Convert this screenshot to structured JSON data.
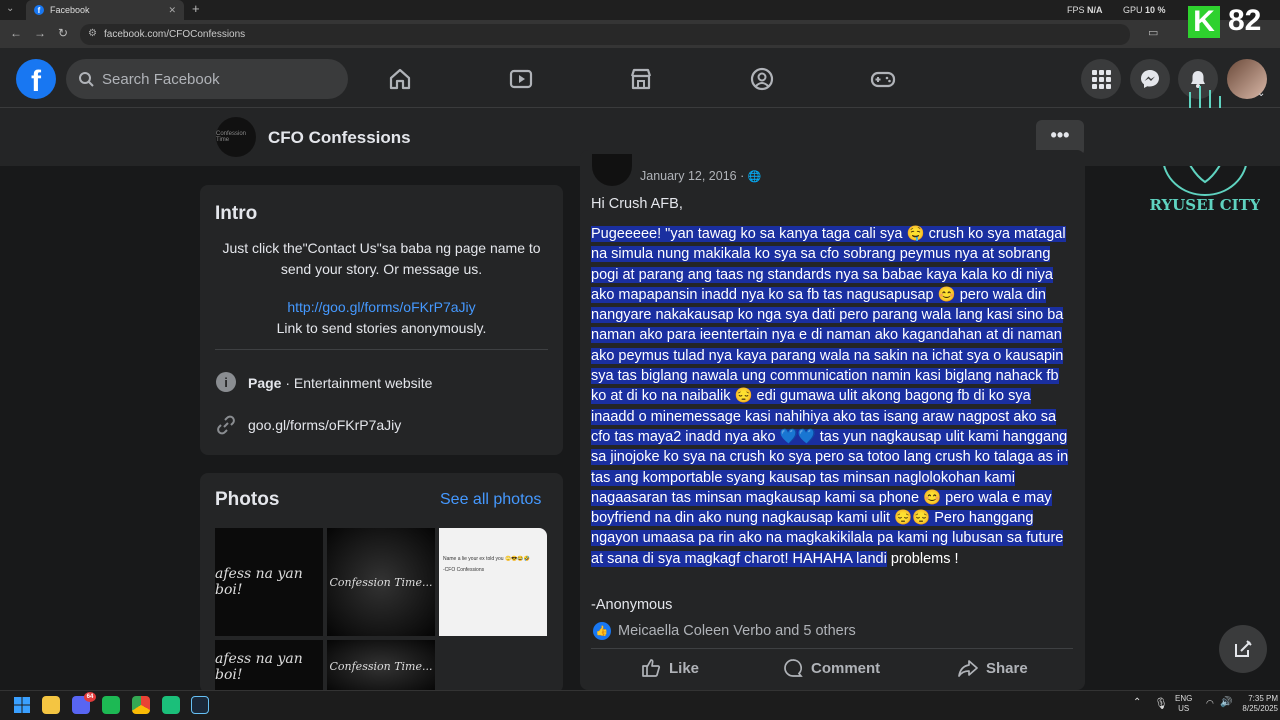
{
  "browser": {
    "tab_title": "Facebook",
    "url": "facebook.com/CFOConfessions",
    "fps_label": "FPS",
    "fps_value": "N/A",
    "gpu_label": "GPU",
    "gpu_value": "10 %",
    "overlay_number": "82",
    "overlay_letter": "K",
    "overlay_brand_text": "RYUSEI CITY"
  },
  "header": {
    "search_placeholder": "Search Facebook",
    "logo_letter": "f"
  },
  "page": {
    "name": "CFO Confessions",
    "avatar_text": "Confession Time",
    "more_label": "•••"
  },
  "intro": {
    "title": "Intro",
    "description": "Just click the\"Contact Us\"sa baba ng page name to send your story. Or message us.",
    "link": "http://goo.gl/forms/oFKrP7aJiy",
    "link_caption": "Link to send stories anonymously.",
    "category_bold": "Page",
    "category_rest": " · Entertainment website",
    "website": "goo.gl/forms/oFKrP7aJiy"
  },
  "photos": {
    "title": "Photos",
    "see_all": "See all photos",
    "items": [
      {
        "text": "afess na yan boi!"
      },
      {
        "text": "Confession Time..."
      },
      {
        "text": "Name a lie your ex told you 🙄😎😂🤣",
        "sub": "-CFO Confessions"
      },
      {
        "text": "afess na yan boi!"
      },
      {
        "text": "Confession Time..."
      }
    ]
  },
  "post": {
    "date": "January 12, 2016 ·",
    "greeting": "Hi Crush AFB,",
    "body": "Pugeeeee! \"yan tawag ko sa kanya taga cali sya 🤤 crush ko sya matagal na simula nung makikala ko sya sa cfo sobrang peymus nya at sobrang pogi at parang ang taas ng standards nya sa babae kaya kala ko di niya ako mapapansin inadd nya ko sa fb tas nagusapusap 😊 pero wala din nangyare nakakausap ko nga sya dati pero parang wala lang kasi sino ba naman ako para ieentertain nya e di naman ako kagandahan at di naman ako peymus tulad nya kaya parang wala na sakin na ichat sya o kausapin sya  tas biglang nawala ung communication namin kasi biglang nahack fb ko at di ko na naibalik 😔 edi gumawa ulit akong bagong fb di ko sya inaadd o minemessage kasi nahihiya ako tas isang araw nagpost ako sa cfo tas maya2 inadd nya ako 💙💙 tas yun nagkausap ulit kami hanggang sa jinojoke ko sya na crush ko sya pero sa totoo lang crush ko talaga as in tas ang komportable syang kausap tas minsan naglolokohan kami nagaasaran tas minsan magkausap kami sa phone 😊 pero wala e may boyfriend na din ako nung nagkausap kami ulit 😔😔 Pero hanggang ngayon umaasa pa rin ako na magkakikilala pa kami ng lubusan sa future at sana di sya magkagf charot! HAHAHA landi",
    "body_tail": " problems !",
    "signature": "-Anonymous",
    "reactions": "Meicaella Coleen Verbo and 5 others",
    "like_label": "Like",
    "comment_label": "Comment",
    "share_label": "Share"
  },
  "taskbar": {
    "lang_top": "ENG",
    "lang_bottom": "US",
    "time": "7:35 PM",
    "date": "8/25/2025",
    "discord_badge": "64"
  },
  "colors": {
    "fb_blue": "#1877f2",
    "selection": "#1a2fa0",
    "link": "#4599ff"
  }
}
